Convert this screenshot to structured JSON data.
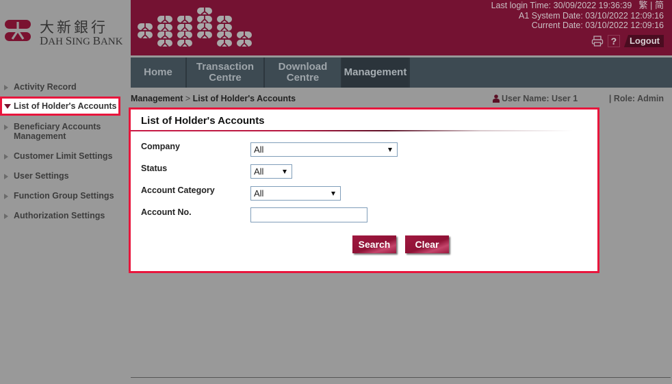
{
  "brand": {
    "name_cn": "大新銀行",
    "name_en_parts": [
      "D",
      "AH ",
      "S",
      "ING ",
      "B",
      "ANK"
    ],
    "primary_color": "#741232",
    "highlight_color": "#e8153c"
  },
  "header": {
    "last_login": "Last login Time: 30/09/2022 19:36:39",
    "lang_traditional": "繁",
    "lang_separator": "|",
    "lang_simplified": "简",
    "system_date": "A1 System Date: 03/10/2022 12:09:16",
    "current_date": "Current Date: 03/10/2022 12:09:16",
    "print_icon": "printer-icon",
    "help_label": "?",
    "logout_label": "Logout"
  },
  "nav": {
    "items": [
      {
        "label_line1": "Home",
        "label_line2": "",
        "active": false
      },
      {
        "label_line1": "Transaction",
        "label_line2": "Centre",
        "active": false
      },
      {
        "label_line1": "Download",
        "label_line2": "Centre",
        "active": false
      },
      {
        "label_line1": "Management",
        "label_line2": "",
        "active": true
      }
    ]
  },
  "sidebar": {
    "items": [
      {
        "label": "Activity Record",
        "active": false
      },
      {
        "label": "List of Holder's Accounts",
        "active": true
      },
      {
        "label_line1": "Beneficiary Accounts",
        "label_line2": "Management",
        "active": false
      },
      {
        "label": "Customer Limit Settings",
        "active": false
      },
      {
        "label": "User Settings",
        "active": false
      },
      {
        "label": "Function Group Settings",
        "active": false
      },
      {
        "label": "Authorization Settings",
        "active": false
      }
    ]
  },
  "breadcrumb": {
    "parent": "Management",
    "separator": " > ",
    "current": "List of Holder's Accounts"
  },
  "user": {
    "user_name": "User Name: User 1",
    "role": "| Role: Admin"
  },
  "panel": {
    "title": "List of Holder's Accounts",
    "fields": {
      "company_label": "Company",
      "company_value": "All",
      "status_label": "Status",
      "status_value": "All",
      "category_label": "Account Category",
      "category_value": "All",
      "account_no_label": "Account No.",
      "account_no_value": ""
    },
    "search_label": "Search",
    "clear_label": "Clear"
  }
}
